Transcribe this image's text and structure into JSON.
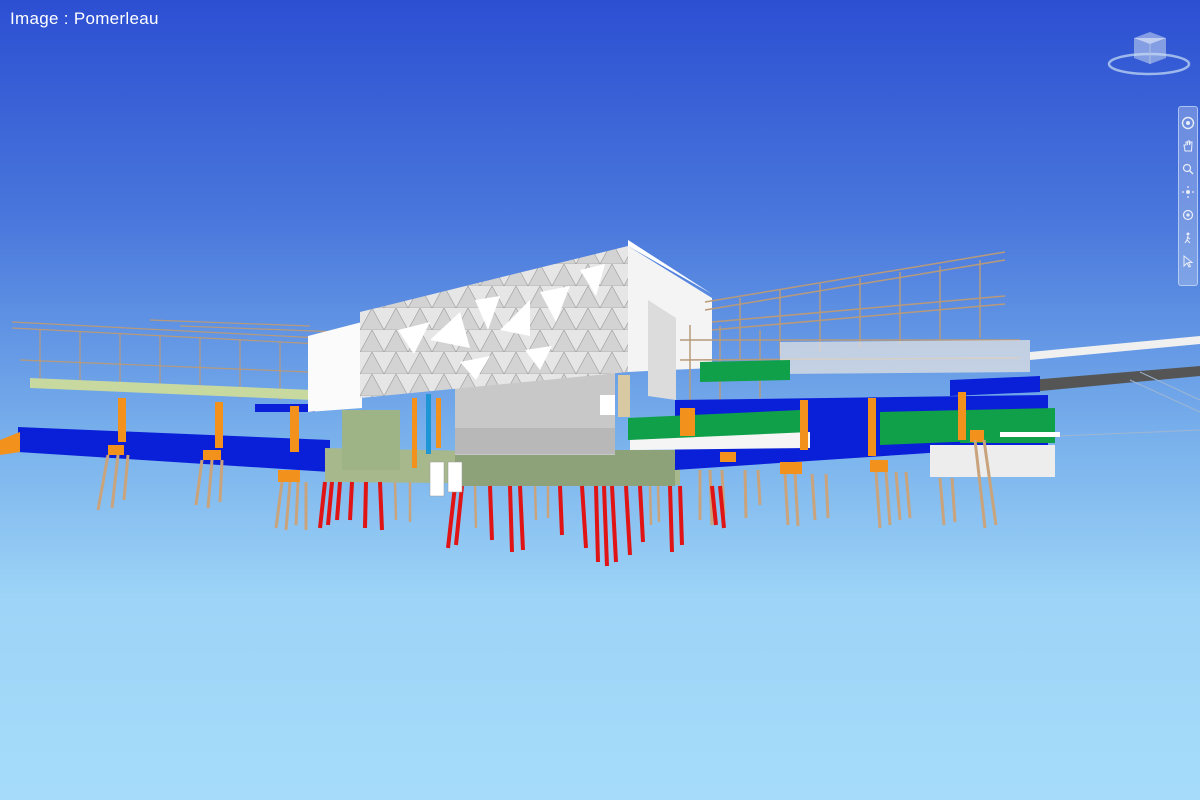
{
  "viewer": {
    "caption": "Image : Pomerleau"
  },
  "viewcube": {
    "icon": "viewcube-icon"
  },
  "navigation_bar": {
    "tools": [
      {
        "icon": "steering-wheel-icon"
      },
      {
        "icon": "pan-hand-icon"
      },
      {
        "icon": "zoom-icon"
      },
      {
        "icon": "orbit-icon"
      },
      {
        "icon": "look-around-icon"
      },
      {
        "icon": "walk-icon"
      },
      {
        "icon": "select-pointer-icon"
      }
    ]
  },
  "colors": {
    "sky_top": "#2c4fd2",
    "sky_bottom": "#a6dcfa",
    "slab_blue": "#0a1fd8",
    "column_orange": "#f2911c",
    "pile_red": "#e01414",
    "pile_tan": "#c9a37c",
    "structure_green": "#11a04a",
    "foundation_sage": "#a6b88c",
    "facade_white": "#f2f2f2",
    "concrete_grey": "#c8c8c8",
    "steel_tan": "#b89a7a"
  }
}
